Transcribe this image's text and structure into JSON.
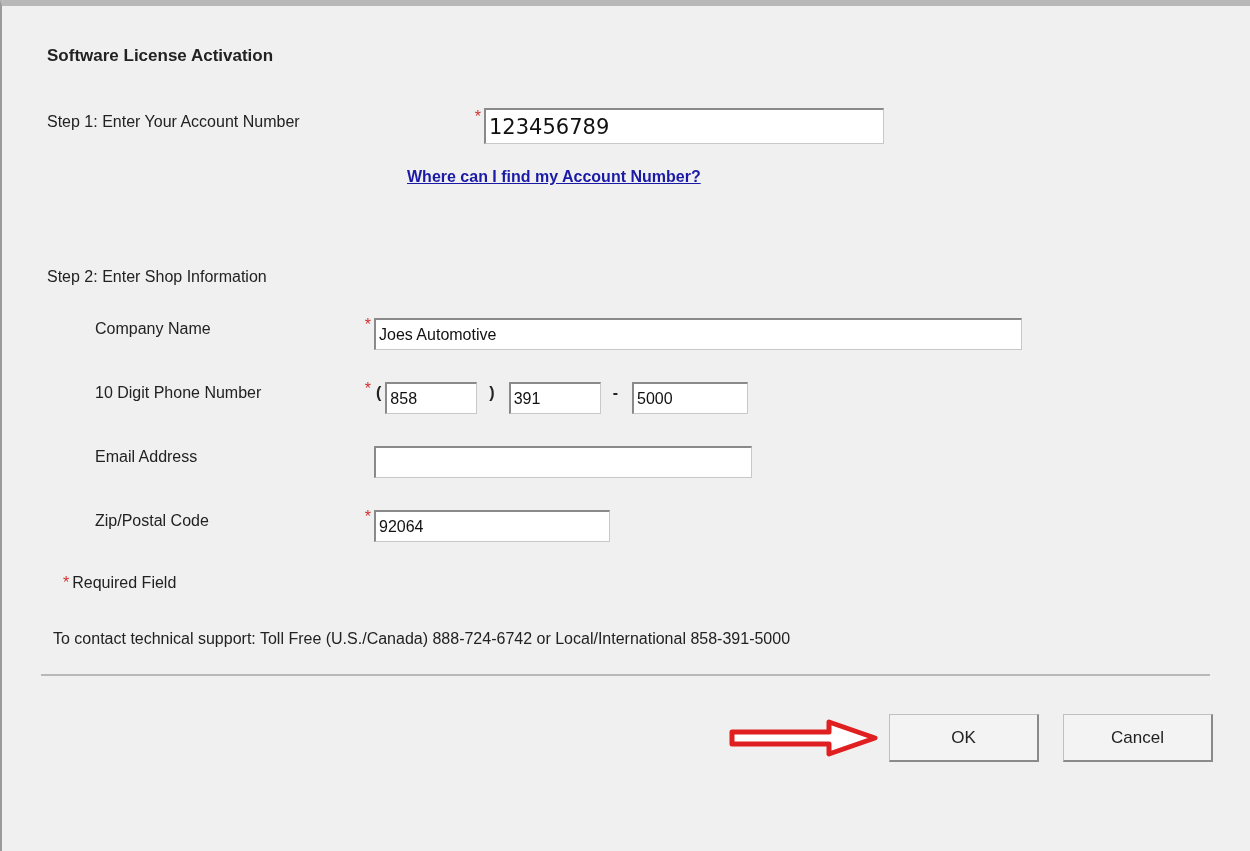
{
  "title": "Software License Activation",
  "required_mark": "*",
  "step1": {
    "label": "Step 1: Enter Your Account Number",
    "required": true,
    "value": "123456789"
  },
  "help_link": "Where can I find my Account Number?",
  "step2": {
    "label": "Step 2: Enter Shop Information"
  },
  "fields": [
    {
      "kind": "text",
      "label": "Company Name",
      "required": true,
      "value": "Joes Automotive"
    },
    {
      "kind": "phone",
      "label": "10 Digit Phone Number",
      "required": true,
      "open": "(",
      "close": ")",
      "dash": "-",
      "parts": [
        "858",
        "391",
        "5000"
      ]
    },
    {
      "kind": "text",
      "label": "Email Address",
      "required": false
    },
    {
      "kind": "short",
      "label": "Zip/Postal Code",
      "required": true,
      "value": "92064"
    }
  ],
  "required_note": "Required Field",
  "support": "To contact technical support:  Toll Free (U.S./Canada) 888-724-6742 or Local/International 858-391-5000",
  "buttons": [
    "OK",
    "Cancel"
  ]
}
